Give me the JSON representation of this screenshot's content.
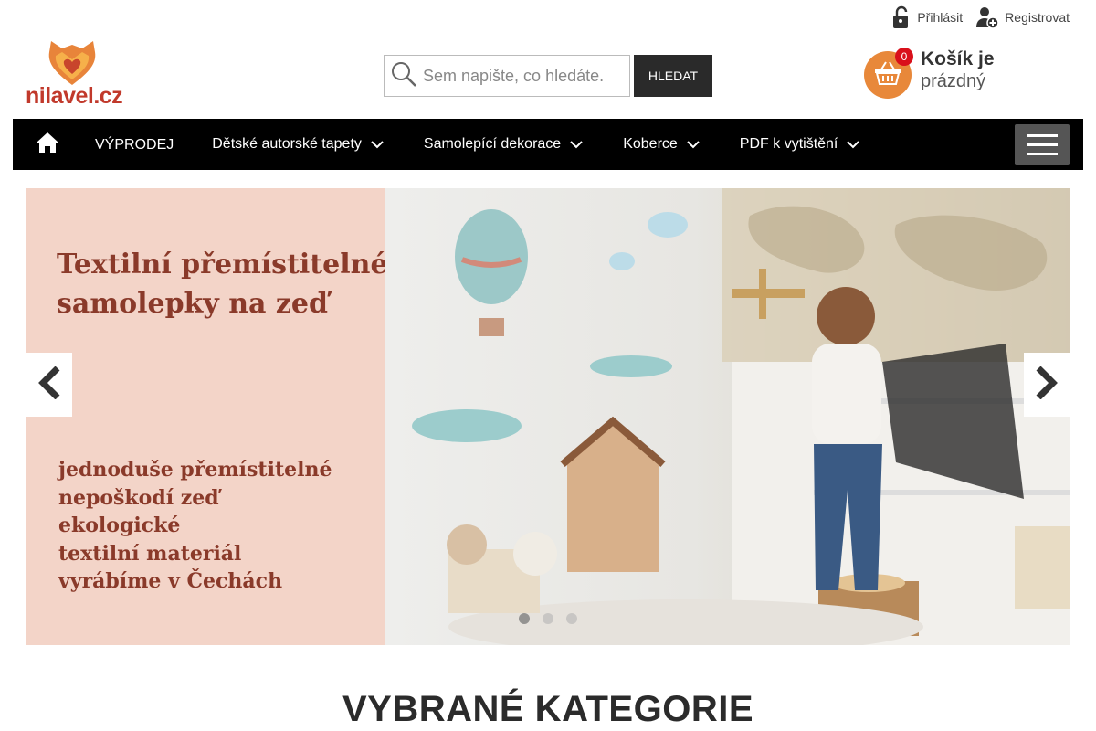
{
  "account": {
    "login_label": "Přihlásit",
    "register_label": "Registrovat"
  },
  "logo": {
    "text": "nilavel.cz",
    "icon": "fox-heart-logo"
  },
  "search": {
    "placeholder": "Sem napište, co hledáte.",
    "button_label": "HLEDAT"
  },
  "cart": {
    "count": "0",
    "title": "Košík je",
    "subtitle": "prázdný"
  },
  "nav": {
    "home_icon": "home-icon",
    "items": [
      {
        "label": "VÝPRODEJ",
        "has_dropdown": false
      },
      {
        "label": "Dětské autorské tapety",
        "has_dropdown": true
      },
      {
        "label": "Samolepící dekorace",
        "has_dropdown": true
      },
      {
        "label": "Koberce",
        "has_dropdown": true
      },
      {
        "label": "PDF k vytištění",
        "has_dropdown": true
      }
    ]
  },
  "slider": {
    "title_lines": [
      "Textilní přemístitelné",
      "samolepky na zeď"
    ],
    "feature_lines": [
      "jednoduše přemístitelné",
      "nepoškodí zeď",
      "ekologické",
      "textilní materiál",
      "vyrábíme v Čechách"
    ],
    "slide_count": 3,
    "active_slide": 1
  },
  "section": {
    "title": "VYBRANÉ KATEGORIE"
  },
  "colors": {
    "nav_bg": "#000000",
    "cart_orange": "#e8883a",
    "badge_red": "#d9101b",
    "slide_text": "#8a3a2a",
    "slide_left_bg": "#f3d4c8"
  }
}
